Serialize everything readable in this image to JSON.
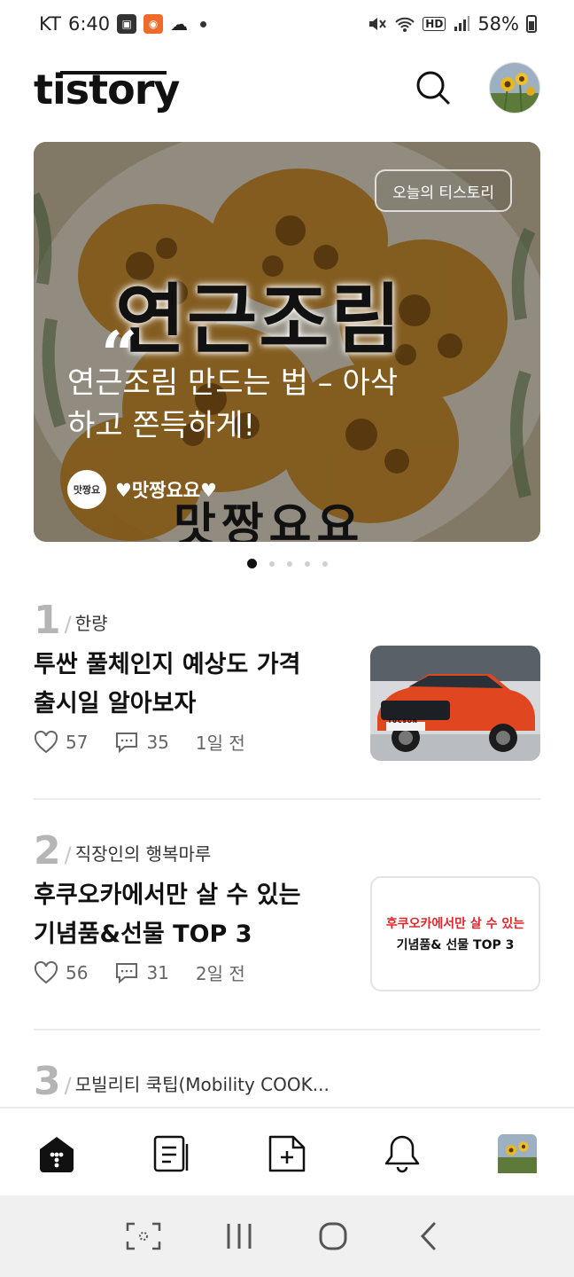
{
  "status_bar": {
    "carrier": "KT",
    "time": "6:40",
    "battery": "58%",
    "hd_label": "HD"
  },
  "header": {
    "logo": "tistory"
  },
  "hero": {
    "badge": "오늘의 티스토리",
    "image_text": "연근조림",
    "quote_mark": "“",
    "title": "연근조림 만드는 법 – 아삭하고 쫀득하게!",
    "author": "♥맛짱요요♥",
    "author_avatar_text": "맛짱요",
    "handwriting": "맛짱요요"
  },
  "carousel": {
    "total": 5,
    "active": 0
  },
  "ranking": [
    {
      "rank": "1",
      "blog": "한량",
      "title": "투싼 풀체인지 예상도 가격 출시일 알아보자",
      "likes": "57",
      "comments": "35",
      "time": "1일 전",
      "thumb_type": "car",
      "thumb_label": "TUCSON"
    },
    {
      "rank": "2",
      "blog": "직장인의 행복마루",
      "title": "후쿠오카에서만 살 수 있는 기념품&선물 TOP 3",
      "likes": "56",
      "comments": "31",
      "time": "2일 전",
      "thumb_type": "text",
      "thumb_line1": "후쿠오카에서만 살 수 있는",
      "thumb_line2": "기념품& 선물 TOP 3"
    },
    {
      "rank": "3",
      "blog": "모빌리티 쿡팁(Mobility COOK..."
    }
  ],
  "bottom_nav": {
    "items": [
      "home-icon",
      "feed-icon",
      "write-icon",
      "notification-icon",
      "profile-avatar"
    ]
  },
  "colors": {
    "accent": "#111111",
    "rank_number": "#b5b5b5",
    "thumb_red": "#e1262b"
  }
}
